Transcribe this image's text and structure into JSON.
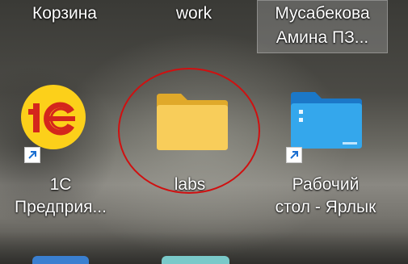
{
  "desktop": {
    "top_row": [
      {
        "label": "Корзина"
      },
      {
        "label": "work"
      },
      {
        "label_line1": "Мусабекова",
        "label_line2": "Амина ПЗ..."
      }
    ],
    "icons": [
      {
        "name": "1c-enterprise",
        "label_line1": "1С",
        "label_line2": "Предприя...",
        "icon": "1c-logo-icon",
        "shortcut": true
      },
      {
        "name": "labs",
        "label_line1": "labs",
        "label_line2": "",
        "icon": "folder-icon",
        "shortcut": false,
        "highlighted": true
      },
      {
        "name": "desktop-shortcut",
        "label_line1": "Рабочий",
        "label_line2": "стол - Ярлык",
        "icon": "desktop-folder-icon",
        "shortcut": true
      }
    ],
    "colors": {
      "highlight": "#d01010",
      "folder": "#f6c44a",
      "onec_logo": "#fcd01a",
      "onec_mark": "#d4261c",
      "desktop_folder": "#2f9be0"
    }
  }
}
